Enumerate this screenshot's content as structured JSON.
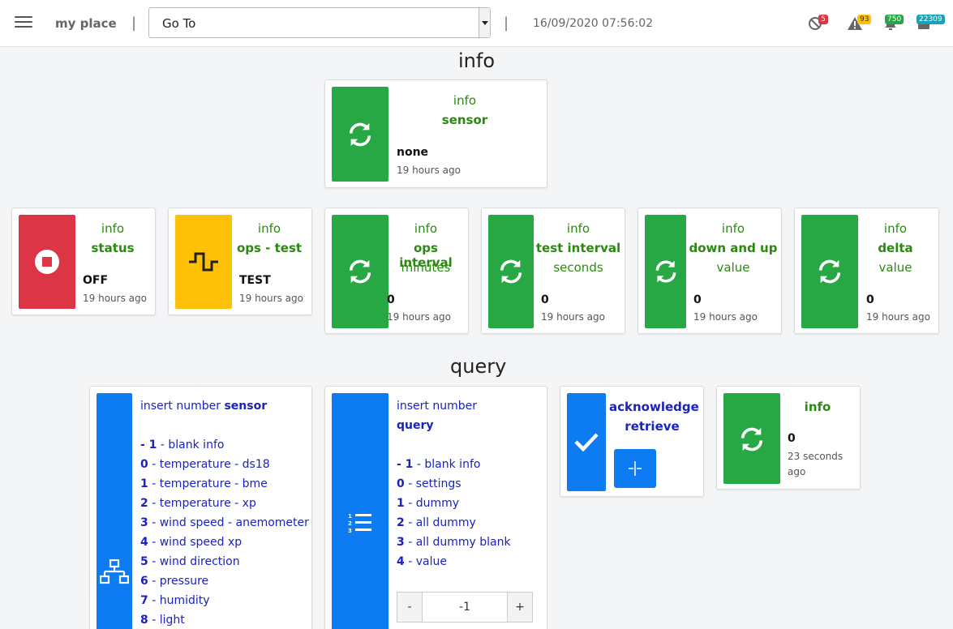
{
  "topbar": {
    "brand": "my place",
    "sep": "|",
    "goto": "Go To",
    "datetime": "16/09/2020 07:56:02",
    "badges": {
      "blocked": "5",
      "warnings": "93",
      "green": "750",
      "teal": "22309"
    },
    "colors": {
      "blocked": "#dc3545",
      "warnings": "#ffc107",
      "green": "#28a745",
      "teal": "#17a2b8"
    }
  },
  "sections": {
    "info": "info",
    "query": "query"
  },
  "cards": {
    "sensor": {
      "l1": "info",
      "l2": "sensor",
      "value": "none",
      "ago": "19 hours ago"
    },
    "status": {
      "l1": "info",
      "l2": "status",
      "value": "OFF",
      "ago": "19 hours ago"
    },
    "ops_test": {
      "l1": "info",
      "l2": "ops - test",
      "value": "TEST",
      "ago": "19 hours ago"
    },
    "ops_interval": {
      "l1": "info",
      "l2": "ops interval",
      "l3": "minutes",
      "value": "0",
      "ago": "19 hours ago"
    },
    "test_interval": {
      "l1": "info",
      "l2": "test interval",
      "l3": "seconds",
      "value": "0",
      "ago": "19 hours ago"
    },
    "down_up": {
      "l1": "info",
      "l2": "down and up",
      "l3": "value",
      "value": "0",
      "ago": "19 hours ago"
    },
    "delta": {
      "l1": "info",
      "l2": "delta",
      "l3": "value",
      "value": "0",
      "ago": "19 hours ago"
    }
  },
  "query": {
    "sensor_card": {
      "title_a": "insert number ",
      "title_b": "sensor",
      "items": [
        {
          "num": "- 1",
          "label": " - blank info"
        },
        {
          "num": "0",
          "label": " - temperature - ds18"
        },
        {
          "num": "1",
          "label": " - temperature - bme"
        },
        {
          "num": "2",
          "label": " - temperature - xp"
        },
        {
          "num": "3",
          "label": " - wind speed - anemometer"
        },
        {
          "num": "4",
          "label": " - wind speed xp"
        },
        {
          "num": "5",
          "label": " - wind direction"
        },
        {
          "num": "6",
          "label": " - pressure"
        },
        {
          "num": "7",
          "label": " - humidity"
        },
        {
          "num": "8",
          "label": " - light"
        }
      ]
    },
    "query_card": {
      "title_a": "insert number",
      "title_b": "query",
      "items": [
        {
          "num": "- 1",
          "label": " - blank info"
        },
        {
          "num": "0",
          "label": " - settings"
        },
        {
          "num": "1",
          "label": " - dummy"
        },
        {
          "num": "2",
          "label": " - all dummy"
        },
        {
          "num": "3",
          "label": " - all dummy blank"
        },
        {
          "num": "4",
          "label": " - value"
        }
      ],
      "minus": "-",
      "plus": "+",
      "value": "-1"
    },
    "ack_card": {
      "l1": "acknowledge",
      "l2": "retrieve"
    },
    "info_card": {
      "l1": "info",
      "value": "0",
      "ago1": "23 seconds",
      "ago2": "ago"
    }
  }
}
